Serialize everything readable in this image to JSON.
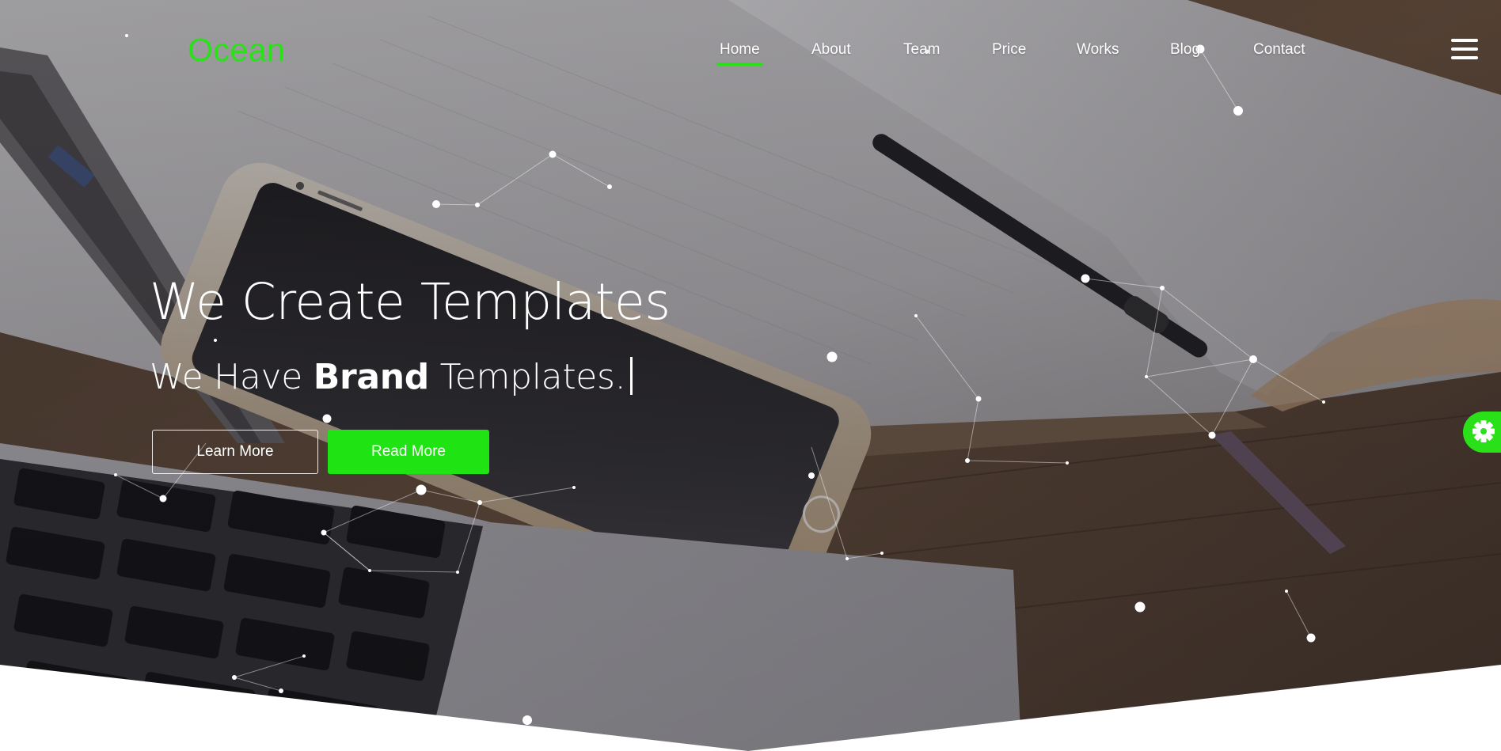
{
  "brand": {
    "logo": "Ocean",
    "accent_color": "#2ae019"
  },
  "nav": {
    "items": [
      {
        "label": "Home",
        "active": true
      },
      {
        "label": "About",
        "active": false
      },
      {
        "label": "Team",
        "active": false
      },
      {
        "label": "Price",
        "active": false
      },
      {
        "label": "Works",
        "active": false
      },
      {
        "label": "Blog",
        "active": false
      },
      {
        "label": "Contact",
        "active": false
      }
    ],
    "menu_icon": "hamburger-menu-icon"
  },
  "hero": {
    "headline": "We Create Templates",
    "subhead_prefix": "We Have",
    "subhead_bold": "Brand",
    "subhead_suffix": "Templates.",
    "buttons": {
      "learn_more": "Learn More",
      "read_more": "Read More"
    },
    "background": "photo-desk-phone-laptop-notebook",
    "overlay": "particle-network"
  },
  "settings_toggle": {
    "icon": "gear-icon",
    "color": "#2ae019"
  }
}
